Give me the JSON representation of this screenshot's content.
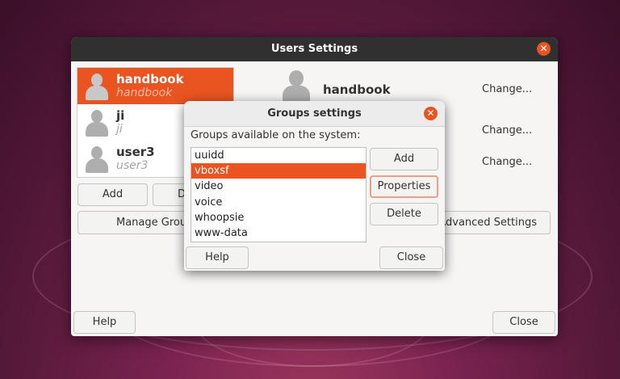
{
  "main_window": {
    "title": "Users Settings",
    "users": [
      {
        "login": "handbook",
        "realname": "handbook",
        "selected": true
      },
      {
        "login": "ji",
        "realname": "ji",
        "selected": false
      },
      {
        "login": "user3",
        "realname": "user3",
        "selected": false
      }
    ],
    "add_label": "Add",
    "delete_label_partial": "D",
    "manage_groups_label_partial": "Manage Grou",
    "advanced_settings_label": "Advanced Settings",
    "detail_name": "handbook",
    "change_labels": [
      "Change...",
      "Change...",
      "Change..."
    ],
    "help_label": "Help",
    "close_label": "Close"
  },
  "groups_dialog": {
    "title": "Groups settings",
    "prompt": "Groups available on the system:",
    "groups": [
      "uuidd",
      "vboxsf",
      "video",
      "voice",
      "whoopsie",
      "www-data"
    ],
    "selected_group": "vboxsf",
    "add_label": "Add",
    "properties_label": "Properties",
    "delete_label": "Delete",
    "help_label": "Help",
    "close_label": "Close"
  },
  "colors": {
    "accent": "#e95420",
    "titlebar": "#303030",
    "window_bg": "#f6f5f4"
  },
  "icons": {
    "close": "close-icon",
    "avatar": "user-avatar-icon"
  }
}
